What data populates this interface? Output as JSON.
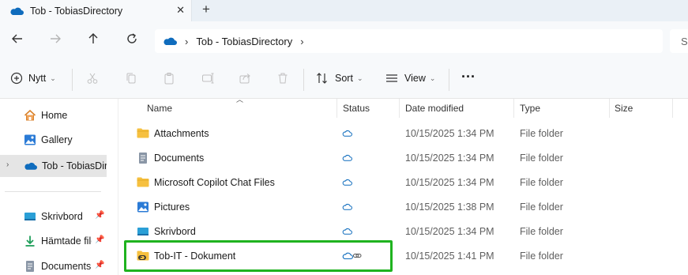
{
  "tab": {
    "title": "Tob - TobiasDirectory",
    "close": "✕",
    "new": "+"
  },
  "address": {
    "crumbs": [
      "Tob - TobiasDirectory"
    ],
    "search_placeholder": "S"
  },
  "toolbar": {
    "new_label": "Nytt",
    "sort_label": "Sort",
    "view_label": "View",
    "more_label": "···"
  },
  "sidebar": {
    "items": [
      {
        "label": "Home",
        "icon": "home-icon"
      },
      {
        "label": "Gallery",
        "icon": "gallery-icon"
      },
      {
        "label": "Tob - TobiasDirectory",
        "icon": "onedrive-icon",
        "selected": true
      },
      {
        "label": "Skrivbord",
        "icon": "desktop-icon",
        "pinned": true
      },
      {
        "label": "Hämtade filer",
        "icon": "download-icon",
        "pinned": true
      },
      {
        "label": "Documents",
        "icon": "document-icon",
        "pinned": true
      }
    ]
  },
  "columns": {
    "name": "Name",
    "status": "Status",
    "date": "Date modified",
    "type": "Type",
    "size": "Size"
  },
  "files": [
    {
      "name": "Attachments",
      "icon": "folder-icon",
      "date": "10/15/2025 1:34 PM",
      "type": "File folder",
      "status": "cloud-icon"
    },
    {
      "name": "Documents",
      "icon": "documents-folder-icon",
      "date": "10/15/2025 1:34 PM",
      "type": "File folder",
      "status": "cloud-icon"
    },
    {
      "name": "Microsoft Copilot Chat Files",
      "icon": "folder-icon",
      "date": "10/15/2025 1:34 PM",
      "type": "File folder",
      "status": "cloud-icon"
    },
    {
      "name": "Pictures",
      "icon": "pictures-folder-icon",
      "date": "10/15/2025 1:38 PM",
      "type": "File folder",
      "status": "cloud-icon"
    },
    {
      "name": "Skrivbord",
      "icon": "desktop-folder-icon",
      "date": "10/15/2025 1:34 PM",
      "type": "File folder",
      "status": "cloud-icon"
    },
    {
      "name": "Tob-IT - Dokument",
      "icon": "shared-folder-icon",
      "date": "10/15/2025 1:41 PM",
      "type": "File folder",
      "status": "cloud-link-icon"
    }
  ],
  "colors": {
    "accent": "#0f6cbd",
    "folder": "#f6c03f",
    "highlight": "#1fb31f"
  }
}
